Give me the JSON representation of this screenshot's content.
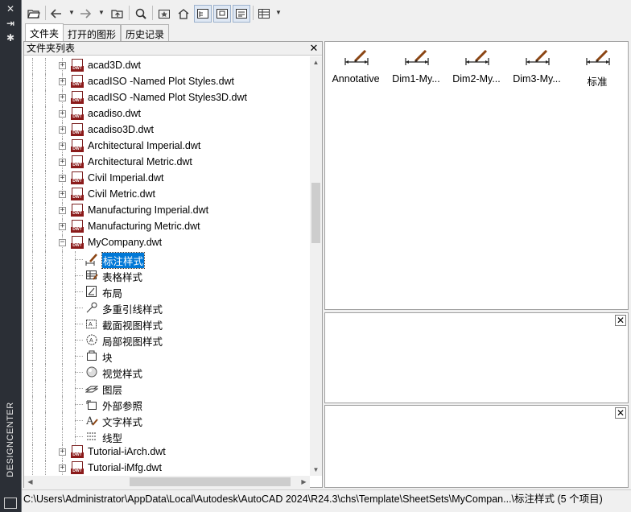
{
  "sidebar": {
    "title": "DESIGNCENTER",
    "buttons": [
      "close-icon",
      "autohide-icon",
      "properties-icon"
    ]
  },
  "toolbar": {
    "buttons": [
      "load-icon",
      "back-icon",
      "forward-icon",
      "up-icon",
      "search-icon",
      "favorites-icon",
      "home-icon",
      "tree-toggle-icon",
      "preview-icon",
      "description-icon",
      "views-icon"
    ]
  },
  "tabs": [
    {
      "label": "文件夹",
      "active": true
    },
    {
      "label": "打开的图形",
      "active": false
    },
    {
      "label": "历史记录",
      "active": false
    }
  ],
  "folder_panel": {
    "header": "文件夹列表",
    "close_symbol": "✕"
  },
  "tree": [
    {
      "label": "acad3D.dwt",
      "type": "file",
      "expanded": false
    },
    {
      "label": "acadISO -Named Plot Styles.dwt",
      "type": "file",
      "expanded": false
    },
    {
      "label": "acadISO -Named Plot Styles3D.dwt",
      "type": "file",
      "expanded": false
    },
    {
      "label": "acadiso.dwt",
      "type": "file",
      "expanded": false
    },
    {
      "label": "acadiso3D.dwt",
      "type": "file",
      "expanded": false
    },
    {
      "label": "Architectural Imperial.dwt",
      "type": "file",
      "expanded": false
    },
    {
      "label": "Architectural Metric.dwt",
      "type": "file",
      "expanded": false
    },
    {
      "label": "Civil Imperial.dwt",
      "type": "file",
      "expanded": false
    },
    {
      "label": "Civil Metric.dwt",
      "type": "file",
      "expanded": false
    },
    {
      "label": "Manufacturing Imperial.dwt",
      "type": "file",
      "expanded": false
    },
    {
      "label": "Manufacturing Metric.dwt",
      "type": "file",
      "expanded": false
    },
    {
      "label": "MyCompany.dwt",
      "type": "file",
      "expanded": true
    },
    {
      "label": "标注样式",
      "type": "child",
      "icon": "dimstyle-icon",
      "selected": true
    },
    {
      "label": "表格样式",
      "type": "child",
      "icon": "tablestyle-icon"
    },
    {
      "label": "布局",
      "type": "child",
      "icon": "layout-icon"
    },
    {
      "label": "多重引线样式",
      "type": "child",
      "icon": "mleaderstyle-icon"
    },
    {
      "label": "截面视图样式",
      "type": "child",
      "icon": "sectionview-icon"
    },
    {
      "label": "局部视图样式",
      "type": "child",
      "icon": "detailview-icon"
    },
    {
      "label": "块",
      "type": "child",
      "icon": "block-icon"
    },
    {
      "label": "视觉样式",
      "type": "child",
      "icon": "visualstyle-icon"
    },
    {
      "label": "图层",
      "type": "child",
      "icon": "layer-icon"
    },
    {
      "label": "外部参照",
      "type": "child",
      "icon": "xref-icon"
    },
    {
      "label": "文字样式",
      "type": "child",
      "icon": "textstyle-icon"
    },
    {
      "label": "线型",
      "type": "child",
      "icon": "linetype-icon"
    },
    {
      "label": "Tutorial-iArch.dwt",
      "type": "file",
      "expanded": false
    },
    {
      "label": "Tutorial-iMfg.dwt",
      "type": "file",
      "expanded": false
    }
  ],
  "content_items": [
    {
      "label": "Annotative",
      "icon": "dimstyle-icon"
    },
    {
      "label": "Dim1-My...",
      "icon": "dimstyle-icon"
    },
    {
      "label": "Dim2-My...",
      "icon": "dimstyle-icon"
    },
    {
      "label": "Dim3-My...",
      "icon": "dimstyle-icon"
    },
    {
      "label": "标准",
      "icon": "dimstyle-icon"
    }
  ],
  "panel_close_symbol": "✕",
  "status_bar": {
    "text": "C:\\Users\\Administrator\\AppData\\Local\\Autodesk\\AutoCAD 2024\\R24.3\\chs\\Template\\SheetSets\\MyCompan...\\标注样式 (5 个项目)"
  },
  "colors": {
    "selection": "#0078d7",
    "dwt_icon": "#8b1a1a",
    "strip_bg": "#2b2f36"
  }
}
